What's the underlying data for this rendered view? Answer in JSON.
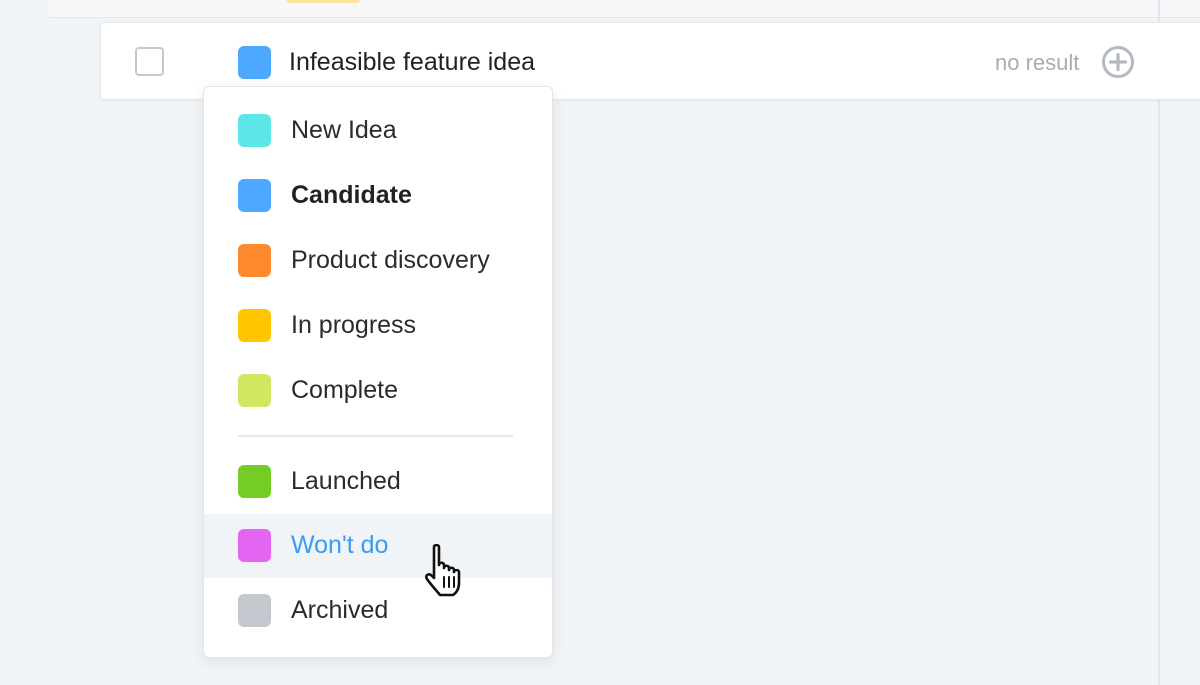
{
  "row": {
    "title": "Infeasible feature idea",
    "status_color": "#4ea8ff",
    "result": "no result"
  },
  "menu": {
    "items": [
      {
        "label": "New Idea",
        "color": "#5ce6e8",
        "selected": false
      },
      {
        "label": "Candidate",
        "color": "#4ea8ff",
        "selected": true
      },
      {
        "label": "Product discovery",
        "color": "#ff8a2e",
        "selected": false
      },
      {
        "label": "In progress",
        "color": "#ffc600",
        "selected": false
      },
      {
        "label": "Complete",
        "color": "#cfe85f",
        "selected": false
      },
      {
        "label": "Launched",
        "color": "#74cc25",
        "selected": false
      },
      {
        "label": "Won't do",
        "color": "#e365f2",
        "selected": false,
        "hovered": true
      },
      {
        "label": "Archived",
        "color": "#c3c8ce",
        "selected": false
      }
    ]
  },
  "colors": {
    "accent": "#3a9bef",
    "background": "#f1f4f7"
  },
  "icons": {
    "add": "plus-circle-icon",
    "cursor": "hand-pointer-icon"
  }
}
